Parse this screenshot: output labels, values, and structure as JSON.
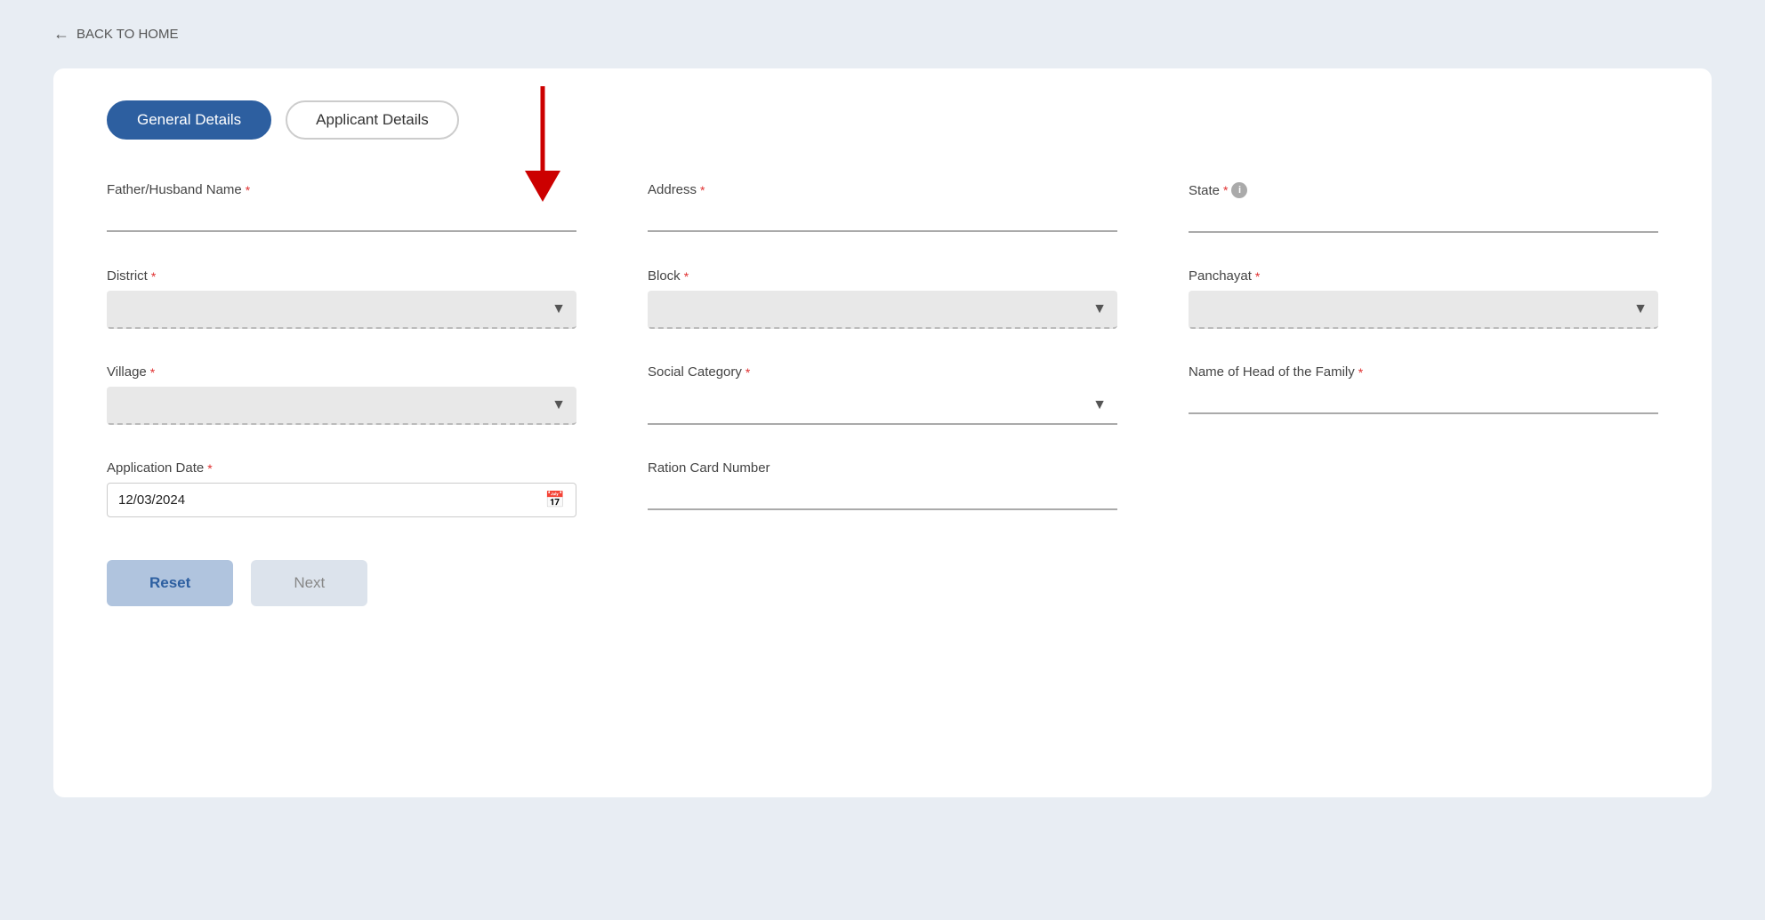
{
  "nav": {
    "back_label": "BACK TO HOME"
  },
  "tabs": [
    {
      "id": "general",
      "label": "General Details",
      "active": true
    },
    {
      "id": "applicant",
      "label": "Applicant Details",
      "active": false
    }
  ],
  "form": {
    "father_husband_name": {
      "label": "Father/Husband Name",
      "required": true,
      "value": "",
      "placeholder": ""
    },
    "address": {
      "label": "Address",
      "required": true,
      "value": "",
      "placeholder": ""
    },
    "state": {
      "label": "State",
      "required": true,
      "has_info": true,
      "value": "",
      "placeholder": ""
    },
    "district": {
      "label": "District",
      "required": true,
      "value": "",
      "options": [
        ""
      ]
    },
    "block": {
      "label": "Block",
      "required": true,
      "value": "",
      "options": [
        ""
      ]
    },
    "panchayat": {
      "label": "Panchayat",
      "required": true,
      "value": "",
      "options": [
        ""
      ]
    },
    "village": {
      "label": "Village",
      "required": true,
      "value": "",
      "options": [
        ""
      ]
    },
    "social_category": {
      "label": "Social Category",
      "required": true,
      "value": "",
      "options": [
        ""
      ]
    },
    "name_of_head": {
      "label": "Name of Head of the Family",
      "required": true,
      "value": "",
      "placeholder": ""
    },
    "application_date": {
      "label": "Application Date",
      "required": true,
      "value": "12/03/2024"
    },
    "ration_card_number": {
      "label": "Ration Card Number",
      "required": false,
      "value": "",
      "placeholder": ""
    }
  },
  "buttons": {
    "reset": "Reset",
    "next": "Next"
  },
  "required_symbol": "*",
  "info_symbol": "i"
}
